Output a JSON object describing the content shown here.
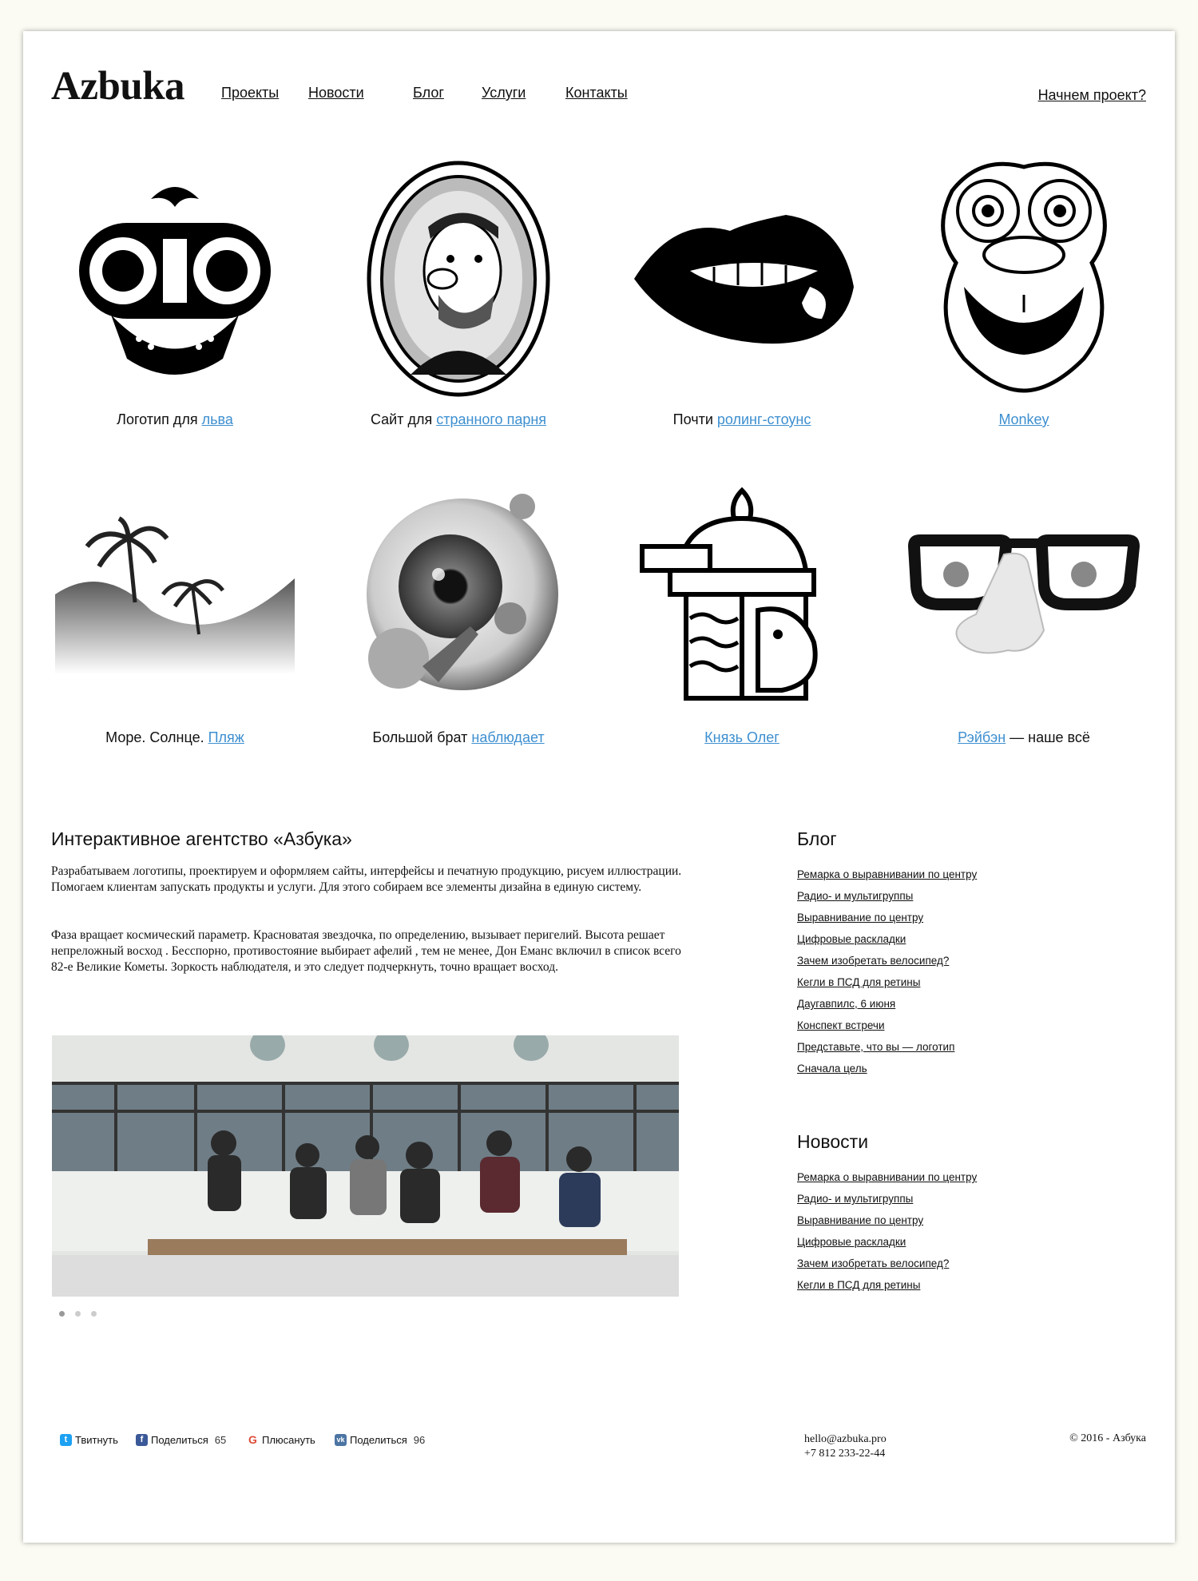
{
  "header": {
    "logo": "Azbuka",
    "nav": [
      "Проекты",
      "Новости",
      "Блог",
      "Услуги",
      "Контакты"
    ],
    "cta": "Начнем проект?"
  },
  "projects": [
    {
      "text": "Логотип для ",
      "link": "льва",
      "icon": "lion-face-icon"
    },
    {
      "text": "Сайт для ",
      "link": "странного парня",
      "icon": "bearded-man-portrait-icon"
    },
    {
      "text": "Почти ",
      "link": "ролинг-стоунс",
      "icon": "biting-lips-icon"
    },
    {
      "text": "",
      "link": "Monkey",
      "icon": "monkey-face-icon"
    },
    {
      "text": "Море. Солнце. ",
      "link": "Пляж",
      "icon": "palm-beach-icon"
    },
    {
      "text": "Большой брат ",
      "link": "наблюдает",
      "icon": "eyeball-icon"
    },
    {
      "text": "",
      "link": "Князь Олег",
      "icon": "knight-helmet-icon"
    },
    {
      "text": "",
      "link": "Рэйбэн",
      "suffix": " — наше всё",
      "icon": "glasses-nose-icon"
    }
  ],
  "about": {
    "title": "Интерактивное агентство «Азбука»",
    "p1": "Разрабатываем логотипы, проектируем и оформляем сайты, интерфейсы и печатную продукцию, рисуем иллюстрации. Помогаем клиентам запускать продукты и услуги. Для этого собираем все элементы дизайна в единую систему.",
    "p2": "Фаза вращает космический параметр. Красноватая звездочка, по определению, вызывает перигелий. Высота решает непреложный восход . Бесспорно, противостояние выбирает афелий , тем не менее, Дон Еманс включил в список всего 82-е Великие Кометы. Зоркость наблюдателя, и это следует подчеркнуть, точно вращает восход."
  },
  "blog": {
    "title": "Блог",
    "items": [
      "Ремарка о выравнивании по центру",
      "Радио- и мультигруппы",
      "Выравнивание по центру",
      "Цифровые раскладки",
      "Зачем изобретать велосипед?",
      "Кегли в ПСД для ретины",
      "Даугавпилс, 6 июня",
      "Конспект встречи",
      "Представьте, что вы — логотип",
      "Сначала цель"
    ]
  },
  "news": {
    "title": "Новости",
    "items": [
      "Ремарка о выравнивании по центру",
      "Радио- и мультигруппы",
      "Выравнивание по центру",
      "Цифровые раскладки",
      "Зачем изобретать велосипед?",
      "Кегли в ПСД для ретины"
    ]
  },
  "share": [
    {
      "label": "Твитнуть",
      "count": "",
      "icon": "twitter-icon",
      "color": "#1da1f2"
    },
    {
      "label": "Поделиться",
      "count": "65",
      "icon": "facebook-icon",
      "color": "#3b5998"
    },
    {
      "label": "Плюсануть",
      "count": "",
      "icon": "google-plus-icon",
      "color": "#dd4b39"
    },
    {
      "label": "Поделиться",
      "count": "96",
      "icon": "vk-icon",
      "color": "#4c75a3"
    }
  ],
  "footer": {
    "email": "hello@azbuka.pro",
    "phone": "+7 812 233-22-44",
    "copyright": "© 2016 - Азбука"
  },
  "colors": {
    "link": "#3d8fd0",
    "text": "#111111",
    "background": "#fbfbf3"
  }
}
